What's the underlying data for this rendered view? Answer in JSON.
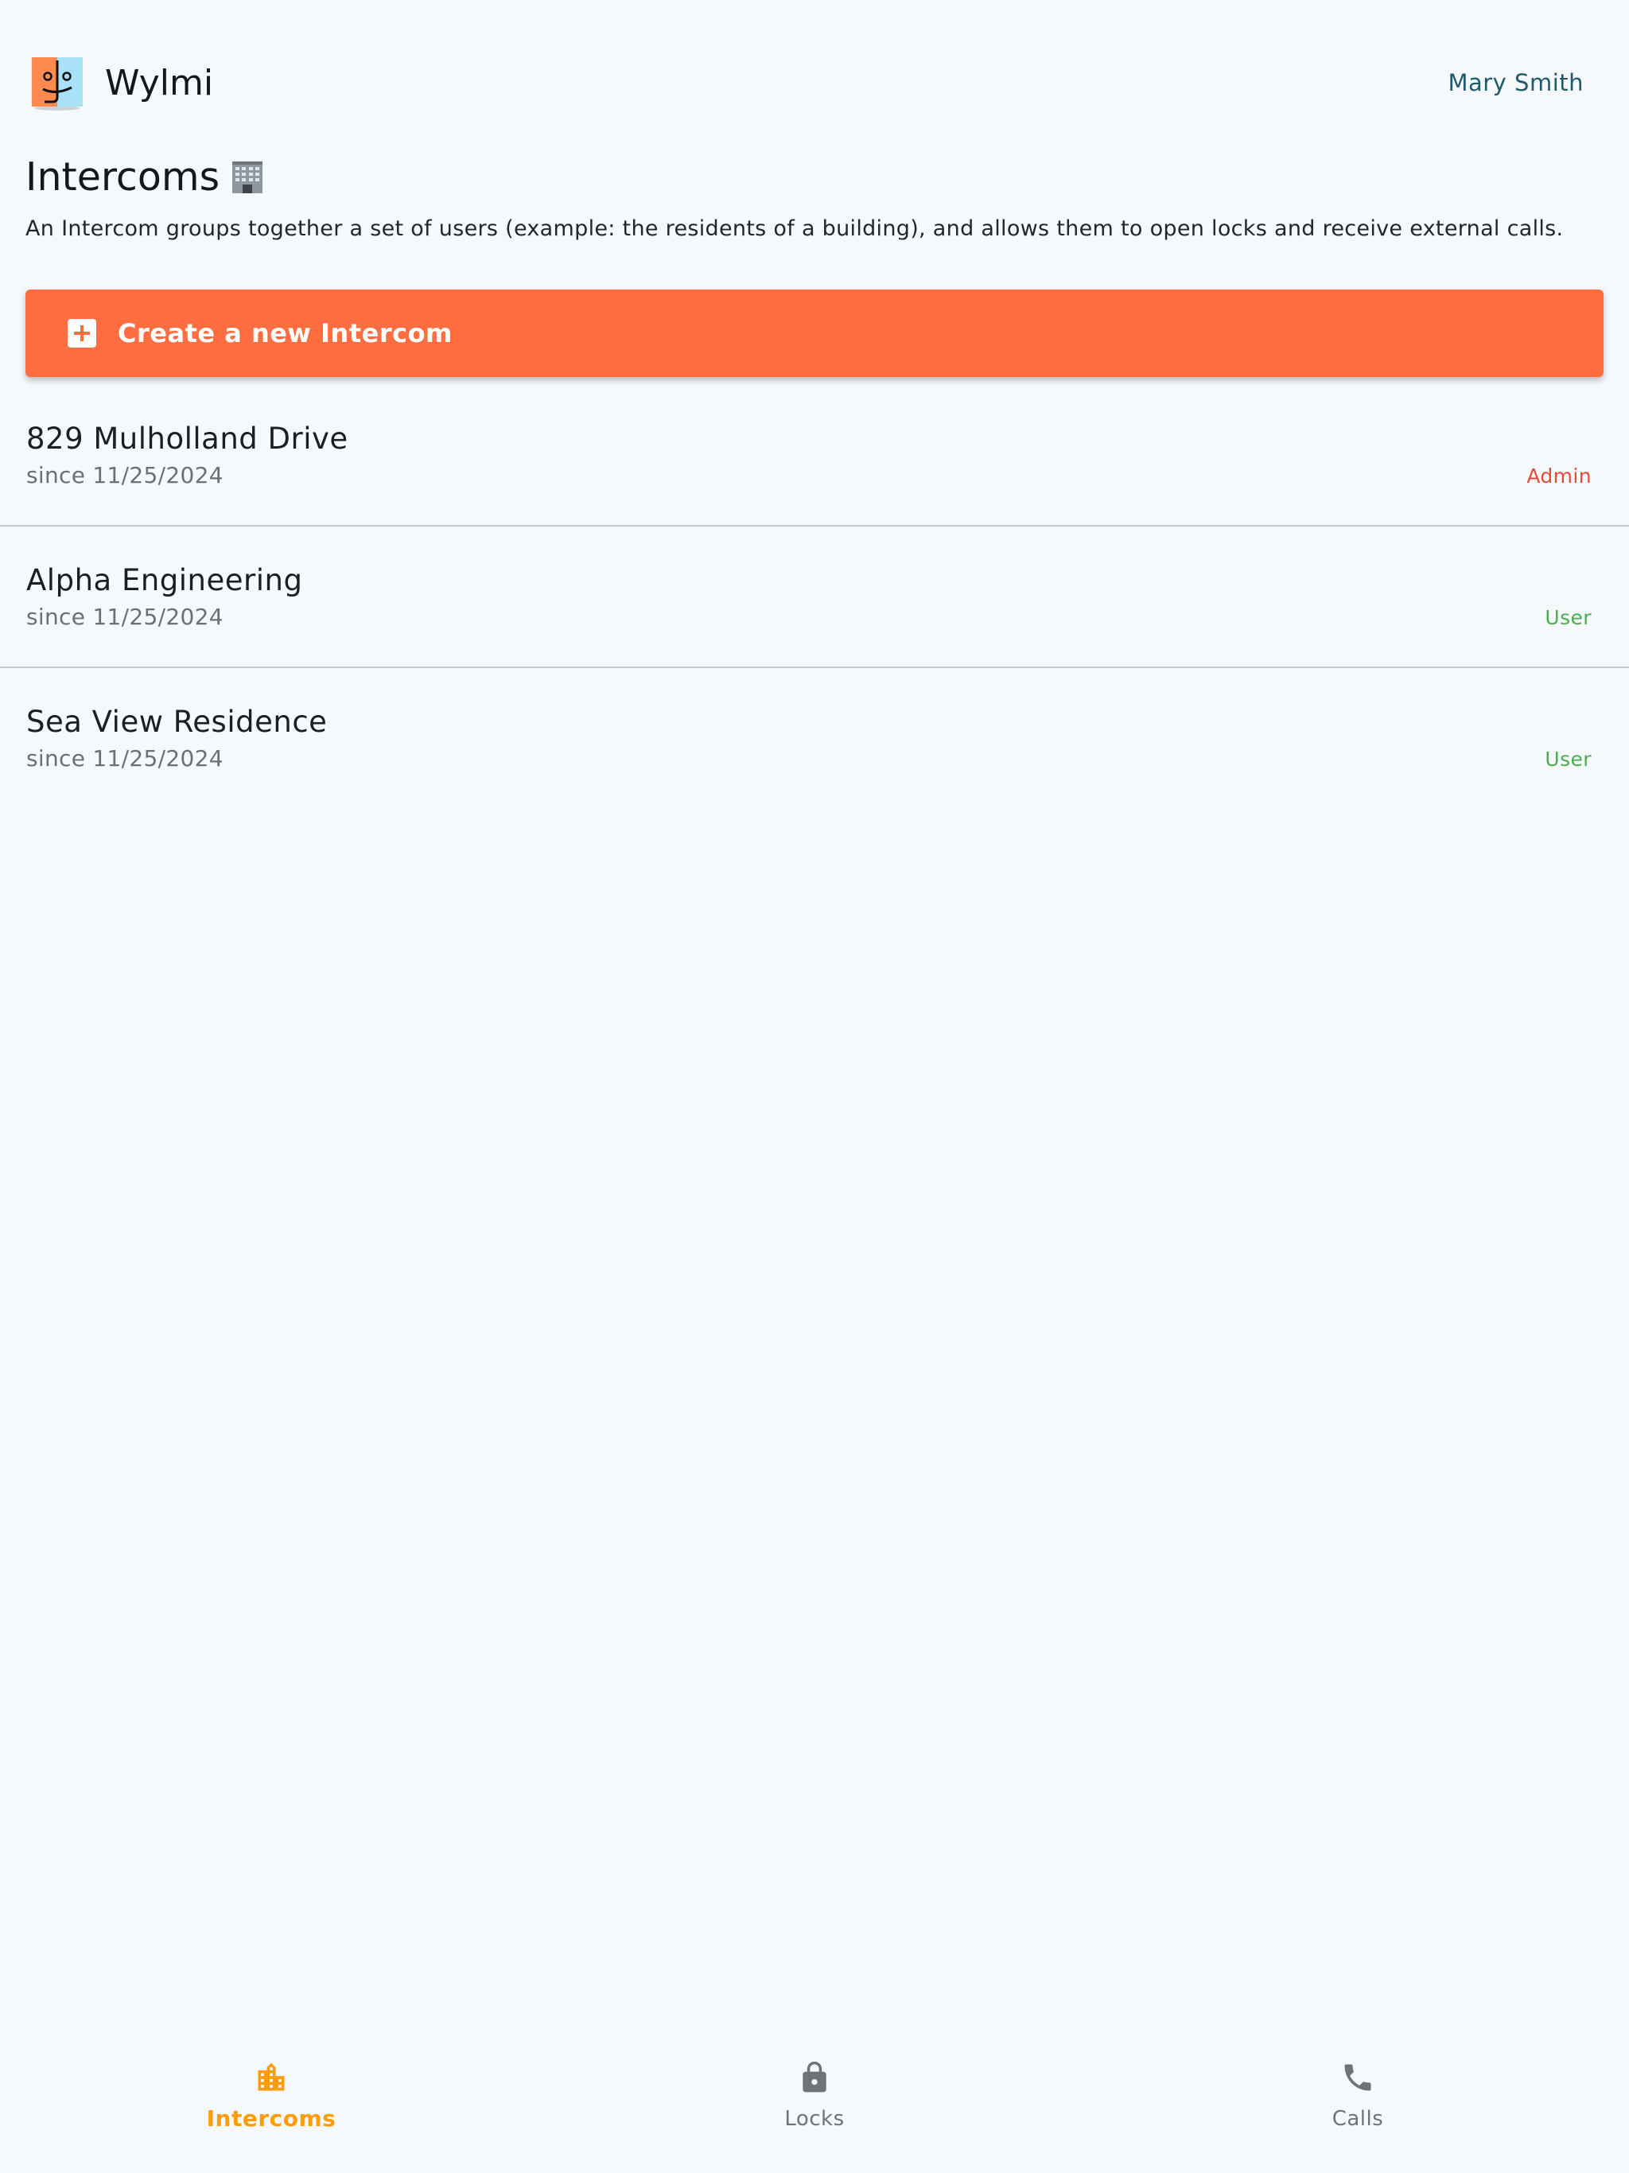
{
  "colors": {
    "background": "#f5f9fc",
    "accent": "#ff6d41",
    "user_name": "#1f5a6a",
    "role_admin": "#e44b3c",
    "role_user": "#4cae50",
    "nav_active": "#ff9c0c",
    "nav_inactive": "#6f7377",
    "divider": "#c6c9cc"
  },
  "header": {
    "app_name": "Wylmi",
    "user_name": "Mary Smith"
  },
  "page": {
    "title": "Intercoms",
    "title_icon": "office-building-icon",
    "description": "An Intercom groups together a set of users (example: the residents of a building), and allows them to open locks and receive external calls."
  },
  "create_button": {
    "label": "Create a new Intercom",
    "icon": "plus-box-icon"
  },
  "intercoms": [
    {
      "name": "829 Mulholland Drive",
      "since": "since 11/25/2024",
      "role": "Admin"
    },
    {
      "name": "Alpha Engineering",
      "since": "since 11/25/2024",
      "role": "User"
    },
    {
      "name": "Sea View Residence",
      "since": "since 11/25/2024",
      "role": "User"
    }
  ],
  "bottom_nav": [
    {
      "label": "Intercoms",
      "icon": "building-icon",
      "active": true
    },
    {
      "label": "Locks",
      "icon": "lock-icon",
      "active": false
    },
    {
      "label": "Calls",
      "icon": "phone-icon",
      "active": false
    }
  ]
}
